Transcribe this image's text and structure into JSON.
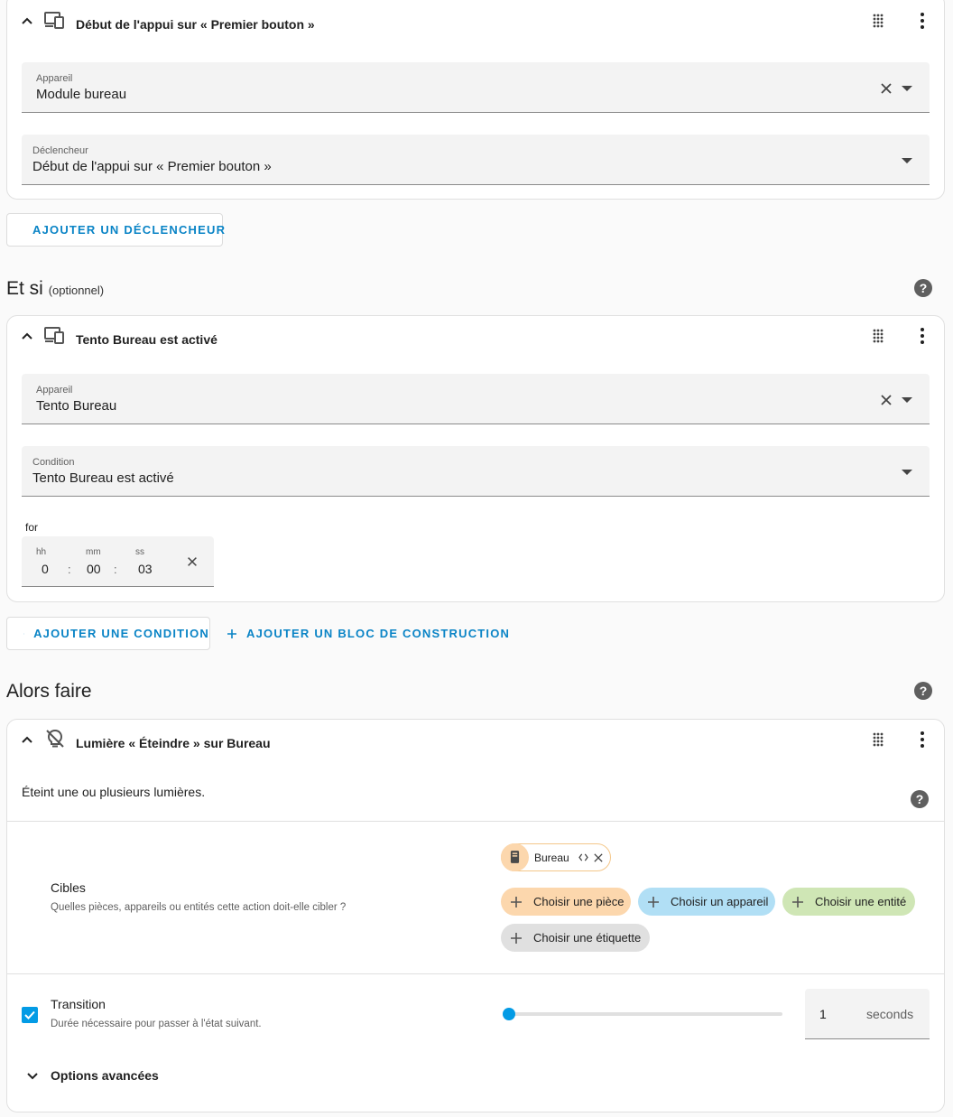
{
  "trigger_card": {
    "title": "Début de l'appui sur « Premier bouton »",
    "device_field": {
      "label": "Appareil",
      "value": "Module bureau"
    },
    "trigger_field": {
      "label": "Déclencheur",
      "value": "Début de l'appui sur « Premier bouton »"
    }
  },
  "add_trigger_button": "AJOUTER UN DÉCLENCHEUR",
  "conditions_section": {
    "title": "Et si",
    "optional": "(optionnel)"
  },
  "condition_card": {
    "title": "Tento Bureau est activé",
    "device_field": {
      "label": "Appareil",
      "value": "Tento Bureau"
    },
    "condition_field": {
      "label": "Condition",
      "value": "Tento Bureau est activé"
    },
    "for_label": "for",
    "duration": {
      "hh_label": "hh",
      "hh": "0",
      "mm_label": "mm",
      "mm": "00",
      "ss_label": "ss",
      "ss": "03",
      "separator": ":"
    }
  },
  "add_condition_button": "AJOUTER UNE CONDITION",
  "add_building_block_button": "AJOUTER UN BLOC DE CONSTRUCTION",
  "actions_section": {
    "title": "Alors faire"
  },
  "action_card": {
    "title": "Lumière « Éteindre » sur Bureau",
    "description": "Éteint une ou plusieurs lumières.",
    "targets": {
      "label": "Cibles",
      "helper": "Quelles pièces, appareils ou entités cette action doit-elle cibler ?",
      "selected_chip": "Bureau",
      "choose_area": "Choisir une pièce",
      "choose_device": "Choisir un appareil",
      "choose_entity": "Choisir une entité",
      "choose_label": "Choisir une étiquette"
    },
    "transition": {
      "checked": true,
      "label": "Transition",
      "helper": "Durée nécessaire pour passer à l'état suivant.",
      "slider_value": 1,
      "input_value": "1",
      "unit": "seconds"
    },
    "advanced_options": "Options avancées"
  },
  "colors": {
    "accent": "#0a84c6",
    "area_chip": "#fcd7ad",
    "device_chip": "#b1dff5",
    "entity_chip": "#cfe6b5",
    "label_chip": "#e0e0e0",
    "selected_chip_bg": "#fdebd3",
    "help_icon": "#5f5f5f"
  }
}
